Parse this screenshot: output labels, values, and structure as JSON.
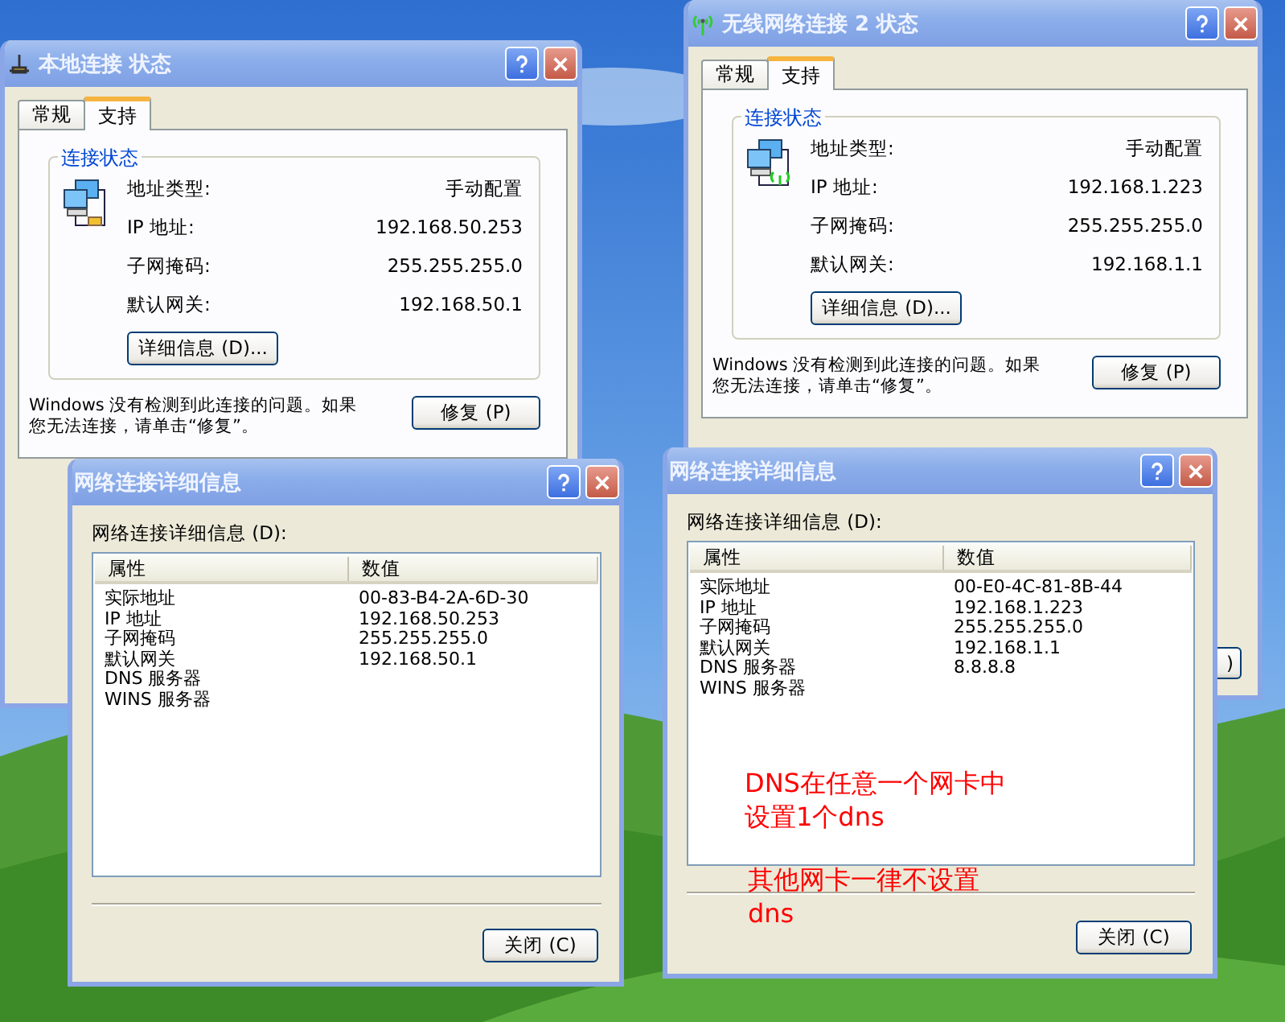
{
  "status_windows": [
    {
      "kind": "wired",
      "title": "本地连接 状态",
      "tabs": [
        {
          "label": "常规",
          "selected": false
        },
        {
          "label": "支持",
          "selected": true
        }
      ],
      "group_title": "连接状态",
      "rows": [
        {
          "label": "地址类型:",
          "value": "手动配置"
        },
        {
          "label": "IP 地址:",
          "value": "192.168.50.253"
        },
        {
          "label": "子网掩码:",
          "value": "255.255.255.0"
        },
        {
          "label": "默认网关:",
          "value": "192.168.50.1"
        }
      ],
      "details_button": "详细信息 (D)...",
      "message_lines": [
        "Windows 没有检测到此连接的问题。如果",
        "您无法连接，请单击“修复”。"
      ],
      "repair_button": "修复 (P)"
    },
    {
      "kind": "wireless",
      "title": "无线网络连接 2 状态",
      "tabs": [
        {
          "label": "常规",
          "selected": false
        },
        {
          "label": "支持",
          "selected": true
        }
      ],
      "group_title": "连接状态",
      "rows": [
        {
          "label": "地址类型:",
          "value": "手动配置"
        },
        {
          "label": "IP 地址:",
          "value": "192.168.1.223"
        },
        {
          "label": "子网掩码:",
          "value": "255.255.255.0"
        },
        {
          "label": "默认网关:",
          "value": "192.168.1.1"
        }
      ],
      "details_button": "详细信息 (D)...",
      "message_lines": [
        "Windows 没有检测到此连接的问题。如果",
        "您无法连接，请单击“修复”。"
      ],
      "repair_button": "修复 (P)",
      "close_button": ")"
    }
  ],
  "details_windows": [
    {
      "title": "网络连接详细信息",
      "list_label": "网络连接详细信息 (D):",
      "columns": [
        "属性",
        "数值"
      ],
      "rows": [
        {
          "property": "实际地址",
          "value": "00-83-B4-2A-6D-30"
        },
        {
          "property": "IP 地址",
          "value": "192.168.50.253"
        },
        {
          "property": "子网掩码",
          "value": "255.255.255.0"
        },
        {
          "property": "默认网关",
          "value": "192.168.50.1"
        },
        {
          "property": "DNS 服务器"
        },
        {
          "property": "WINS 服务器"
        }
      ],
      "close_button": "关闭 (C)"
    },
    {
      "title": "网络连接详细信息",
      "list_label": "网络连接详细信息 (D):",
      "columns": [
        "属性",
        "数值"
      ],
      "rows": [
        {
          "property": "实际地址",
          "value": "00-E0-4C-81-8B-44"
        },
        {
          "property": "IP 地址",
          "value": "192.168.1.223"
        },
        {
          "property": "子网掩码",
          "value": "255.255.255.0"
        },
        {
          "property": "默认网关",
          "value": "192.168.1.1"
        },
        {
          "property": "DNS 服务器",
          "value": "8.8.8.8"
        },
        {
          "property": "WINS 服务器"
        }
      ],
      "close_button": "关闭 (C)"
    }
  ],
  "annotations": [
    {
      "lines": [
        "DNS在任意一个网卡中",
        "设置1个dns"
      ]
    },
    {
      "lines": [
        "其他网卡一律不设置",
        "dns"
      ]
    }
  ]
}
